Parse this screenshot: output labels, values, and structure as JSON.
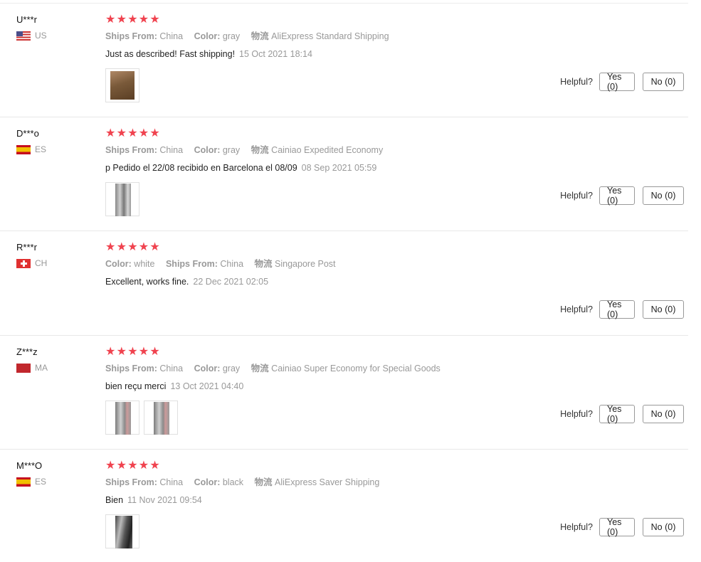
{
  "helpful_label": "Helpful?",
  "star_glyph": "★",
  "reviews": [
    {
      "user": "U***r",
      "country": "US",
      "flag": "us",
      "attrs": [
        {
          "key": "Ships From:",
          "value": "China"
        },
        {
          "key": "Color:",
          "value": "gray"
        },
        {
          "key": "物流",
          "value": "AliExpress Standard Shipping"
        }
      ],
      "text": "Just as described! Fast shipping!",
      "date": "15 Oct 2021 18:14",
      "photos": 1,
      "yes": "Yes (0)",
      "no": "No (0)"
    },
    {
      "user": "D***o",
      "country": "ES",
      "flag": "es",
      "attrs": [
        {
          "key": "Ships From:",
          "value": "China"
        },
        {
          "key": "Color:",
          "value": "gray"
        },
        {
          "key": "物流",
          "value": "Cainiao Expedited Economy"
        }
      ],
      "text": "p Pedido el 22/08 recibido en Barcelona el 08/09",
      "date": "08 Sep 2021 05:59",
      "photos": 1,
      "yes": "Yes (0)",
      "no": "No (0)"
    },
    {
      "user": "R***r",
      "country": "CH",
      "flag": "ch",
      "attrs": [
        {
          "key": "Color:",
          "value": "white"
        },
        {
          "key": "Ships From:",
          "value": "China"
        },
        {
          "key": "物流",
          "value": "Singapore Post"
        }
      ],
      "text": "Excellent, works fine.",
      "date": "22 Dec 2021 02:05",
      "photos": 0,
      "yes": "Yes (0)",
      "no": "No (0)"
    },
    {
      "user": "Z***z",
      "country": "MA",
      "flag": "ma",
      "attrs": [
        {
          "key": "Ships From:",
          "value": "China"
        },
        {
          "key": "Color:",
          "value": "gray"
        },
        {
          "key": "物流",
          "value": "Cainiao Super Economy for Special Goods"
        }
      ],
      "text": "bien reçu merci",
      "date": "13 Oct 2021 04:40",
      "photos": 2,
      "yes": "Yes (0)",
      "no": "No (0)"
    },
    {
      "user": "M***O",
      "country": "ES",
      "flag": "es",
      "attrs": [
        {
          "key": "Ships From:",
          "value": "China"
        },
        {
          "key": "Color:",
          "value": "black"
        },
        {
          "key": "物流",
          "value": "AliExpress Saver Shipping"
        }
      ],
      "text": "Bien",
      "date": "11 Nov 2021 09:54",
      "photos": 1,
      "yes": "Yes (0)",
      "no": "No (0)"
    }
  ]
}
